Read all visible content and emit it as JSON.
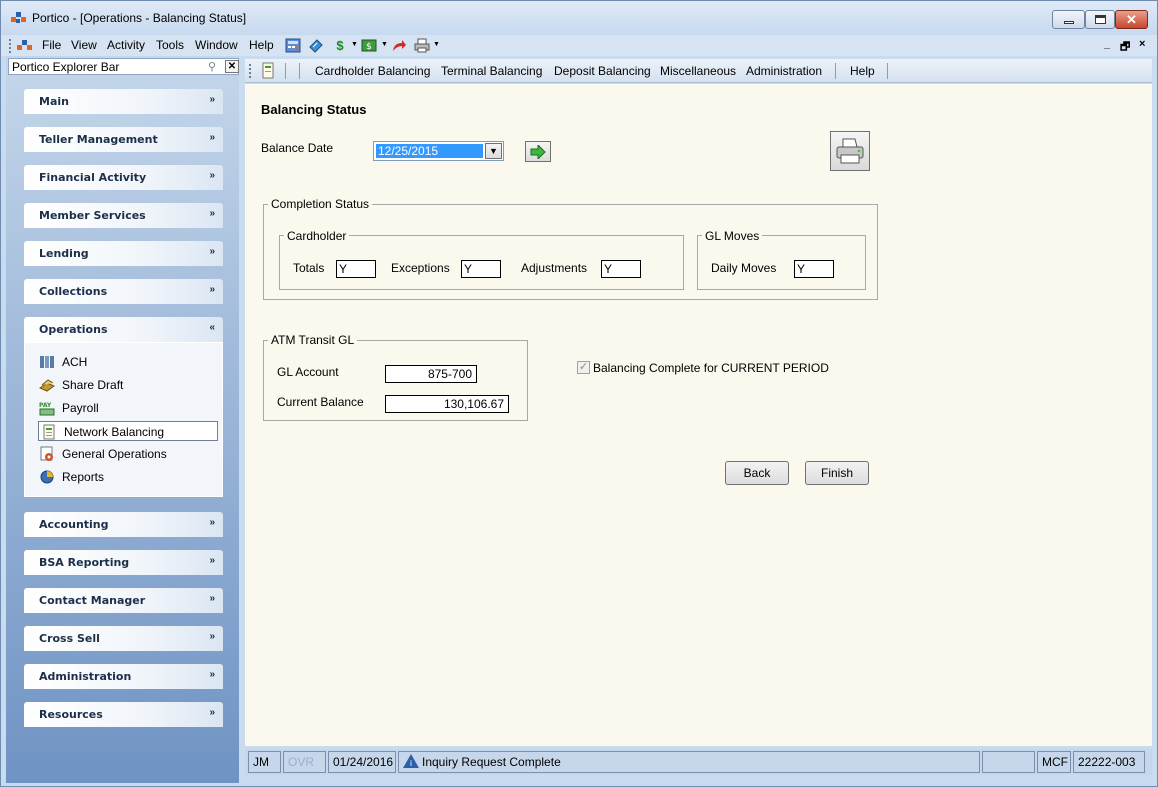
{
  "window": {
    "title": "Portico - [Operations - Balancing Status]"
  },
  "menu": {
    "items": [
      "File",
      "View",
      "Activity",
      "Tools",
      "Window",
      "Help"
    ],
    "mdi_min": "_",
    "mdi_restore": "🗗",
    "mdi_close": "×"
  },
  "explorer": {
    "title": "Portico Explorer Bar",
    "groups": {
      "main": "Main",
      "teller": "Teller Management",
      "financial": "Financial Activity",
      "member": "Member Services",
      "lending": "Lending",
      "collections": "Collections",
      "operations": "Operations",
      "accounting": "Accounting",
      "bsa": "BSA Reporting",
      "contact": "Contact Manager",
      "crosssell": "Cross Sell",
      "administration": "Administration",
      "resources": "Resources"
    },
    "operations_items": [
      "ACH",
      "Share Draft",
      "Payroll",
      "Network Balancing",
      "General Operations",
      "Reports"
    ]
  },
  "nav": {
    "items": [
      "Cardholder Balancing",
      "Terminal Balancing",
      "Deposit Balancing",
      "Miscellaneous",
      "Administration",
      "Help"
    ]
  },
  "page": {
    "title": "Balancing Status",
    "balance_date_label": "Balance Date",
    "balance_date_value": "12/25/2015",
    "completion_status": {
      "title": "Completion Status",
      "cardholder": {
        "title": "Cardholder",
        "totals_label": "Totals",
        "totals_value": "Y",
        "exceptions_label": "Exceptions",
        "exceptions_value": "Y",
        "adjustments_label": "Adjustments",
        "adjustments_value": "Y"
      },
      "gl_moves": {
        "title": "GL Moves",
        "daily_moves_label": "Daily Moves",
        "daily_moves_value": "Y"
      }
    },
    "atm_transit": {
      "title": "ATM Transit GL",
      "gl_account_label": "GL Account",
      "gl_account_value": "875-700",
      "current_balance_label": "Current Balance",
      "current_balance_value": "130,106.67"
    },
    "balancing_complete_label": "Balancing Complete for CURRENT PERIOD",
    "back_label": "Back",
    "finish_label": "Finish"
  },
  "status": {
    "user": "JM",
    "ovr": "OVR",
    "date": "01/24/2016",
    "message": "Inquiry Request Complete",
    "code": "MCF",
    "terminal": "22222-003"
  },
  "colors": {
    "accent": "#3399ff",
    "content_bg": "#fbf9ed",
    "frame": "#c9dbee"
  }
}
